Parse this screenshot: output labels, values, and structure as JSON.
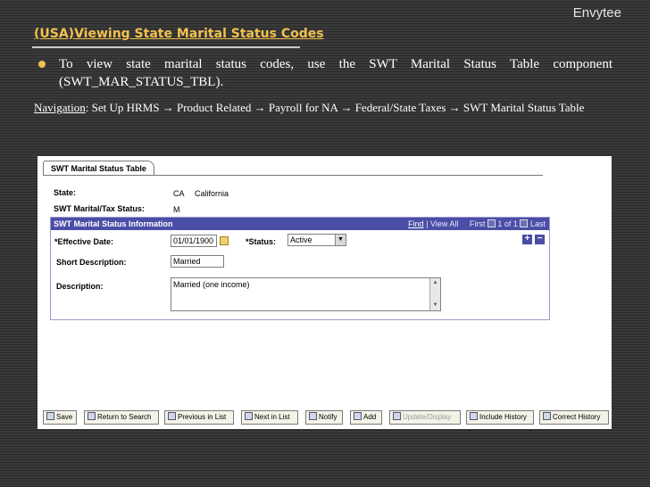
{
  "slide": {
    "brand": "Envytee",
    "title": "(USA)Viewing State Marital Status Codes",
    "bullet": "To view state marital status codes, use the SWT Marital Status Table component (SWT_MAR_STATUS_TBL).",
    "nav_label": "Navigation",
    "nav_steps": [
      "Set Up HRMS",
      "Product Related",
      "Payroll for NA",
      "Federal/State Taxes",
      "SWT Marital Status Table"
    ],
    "arrow": "→"
  },
  "app": {
    "tab_label": "SWT Marital Status Table",
    "state_label": "State:",
    "state_code": "CA",
    "state_name": "California",
    "tax_status_label": "SWT Marital/Tax Status:",
    "tax_status_value": "M",
    "section": {
      "title": "SWT Marital Status Information",
      "find": "Find",
      "sep": "|",
      "view_all": "View All",
      "first": "First",
      "count": "1 of 1",
      "last": "Last"
    },
    "effective_date_label": "*Effective Date:",
    "effective_date_value": "01/01/1900",
    "status_label": "*Status:",
    "status_value": "Active",
    "short_desc_label": "Short Description:",
    "short_desc_value": "Married",
    "desc_label": "Description:",
    "desc_value": "Married (one income)",
    "plus": "+",
    "minus": "−"
  },
  "toolbar": {
    "save": "Save",
    "return_to_search": "Return to Search",
    "previous_in_list": "Previous in List",
    "next_in_list": "Next in List",
    "notify": "Notify",
    "add": "Add",
    "update_display": "Update/Display",
    "include_history": "Include History",
    "correct_history": "Correct History"
  }
}
